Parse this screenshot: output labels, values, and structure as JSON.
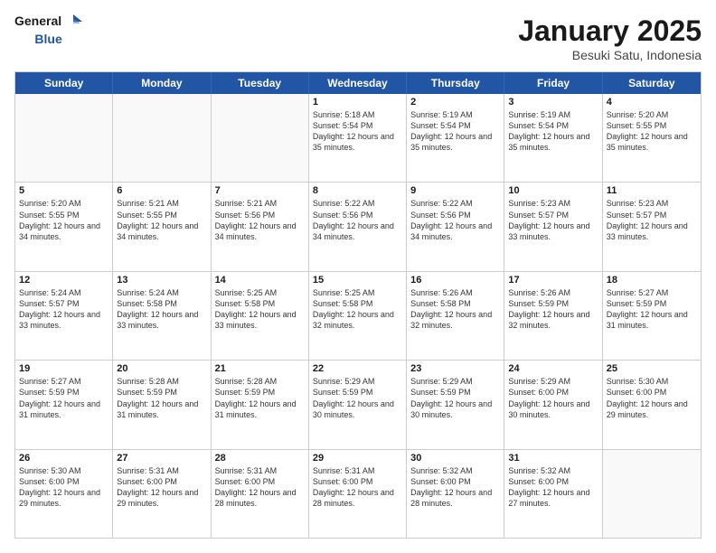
{
  "header": {
    "logo_line1": "General",
    "logo_line2": "Blue",
    "month_title": "January 2025",
    "location": "Besuki Satu, Indonesia"
  },
  "days_of_week": [
    "Sunday",
    "Monday",
    "Tuesday",
    "Wednesday",
    "Thursday",
    "Friday",
    "Saturday"
  ],
  "weeks": [
    [
      {
        "num": "",
        "sunrise": "",
        "sunset": "",
        "daylight": "",
        "empty": true
      },
      {
        "num": "",
        "sunrise": "",
        "sunset": "",
        "daylight": "",
        "empty": true
      },
      {
        "num": "",
        "sunrise": "",
        "sunset": "",
        "daylight": "",
        "empty": true
      },
      {
        "num": "1",
        "sunrise": "Sunrise: 5:18 AM",
        "sunset": "Sunset: 5:54 PM",
        "daylight": "Daylight: 12 hours and 35 minutes."
      },
      {
        "num": "2",
        "sunrise": "Sunrise: 5:19 AM",
        "sunset": "Sunset: 5:54 PM",
        "daylight": "Daylight: 12 hours and 35 minutes."
      },
      {
        "num": "3",
        "sunrise": "Sunrise: 5:19 AM",
        "sunset": "Sunset: 5:54 PM",
        "daylight": "Daylight: 12 hours and 35 minutes."
      },
      {
        "num": "4",
        "sunrise": "Sunrise: 5:20 AM",
        "sunset": "Sunset: 5:55 PM",
        "daylight": "Daylight: 12 hours and 35 minutes."
      }
    ],
    [
      {
        "num": "5",
        "sunrise": "Sunrise: 5:20 AM",
        "sunset": "Sunset: 5:55 PM",
        "daylight": "Daylight: 12 hours and 34 minutes."
      },
      {
        "num": "6",
        "sunrise": "Sunrise: 5:21 AM",
        "sunset": "Sunset: 5:55 PM",
        "daylight": "Daylight: 12 hours and 34 minutes."
      },
      {
        "num": "7",
        "sunrise": "Sunrise: 5:21 AM",
        "sunset": "Sunset: 5:56 PM",
        "daylight": "Daylight: 12 hours and 34 minutes."
      },
      {
        "num": "8",
        "sunrise": "Sunrise: 5:22 AM",
        "sunset": "Sunset: 5:56 PM",
        "daylight": "Daylight: 12 hours and 34 minutes."
      },
      {
        "num": "9",
        "sunrise": "Sunrise: 5:22 AM",
        "sunset": "Sunset: 5:56 PM",
        "daylight": "Daylight: 12 hours and 34 minutes."
      },
      {
        "num": "10",
        "sunrise": "Sunrise: 5:23 AM",
        "sunset": "Sunset: 5:57 PM",
        "daylight": "Daylight: 12 hours and 33 minutes."
      },
      {
        "num": "11",
        "sunrise": "Sunrise: 5:23 AM",
        "sunset": "Sunset: 5:57 PM",
        "daylight": "Daylight: 12 hours and 33 minutes."
      }
    ],
    [
      {
        "num": "12",
        "sunrise": "Sunrise: 5:24 AM",
        "sunset": "Sunset: 5:57 PM",
        "daylight": "Daylight: 12 hours and 33 minutes."
      },
      {
        "num": "13",
        "sunrise": "Sunrise: 5:24 AM",
        "sunset": "Sunset: 5:58 PM",
        "daylight": "Daylight: 12 hours and 33 minutes."
      },
      {
        "num": "14",
        "sunrise": "Sunrise: 5:25 AM",
        "sunset": "Sunset: 5:58 PM",
        "daylight": "Daylight: 12 hours and 33 minutes."
      },
      {
        "num": "15",
        "sunrise": "Sunrise: 5:25 AM",
        "sunset": "Sunset: 5:58 PM",
        "daylight": "Daylight: 12 hours and 32 minutes."
      },
      {
        "num": "16",
        "sunrise": "Sunrise: 5:26 AM",
        "sunset": "Sunset: 5:58 PM",
        "daylight": "Daylight: 12 hours and 32 minutes."
      },
      {
        "num": "17",
        "sunrise": "Sunrise: 5:26 AM",
        "sunset": "Sunset: 5:59 PM",
        "daylight": "Daylight: 12 hours and 32 minutes."
      },
      {
        "num": "18",
        "sunrise": "Sunrise: 5:27 AM",
        "sunset": "Sunset: 5:59 PM",
        "daylight": "Daylight: 12 hours and 31 minutes."
      }
    ],
    [
      {
        "num": "19",
        "sunrise": "Sunrise: 5:27 AM",
        "sunset": "Sunset: 5:59 PM",
        "daylight": "Daylight: 12 hours and 31 minutes."
      },
      {
        "num": "20",
        "sunrise": "Sunrise: 5:28 AM",
        "sunset": "Sunset: 5:59 PM",
        "daylight": "Daylight: 12 hours and 31 minutes."
      },
      {
        "num": "21",
        "sunrise": "Sunrise: 5:28 AM",
        "sunset": "Sunset: 5:59 PM",
        "daylight": "Daylight: 12 hours and 31 minutes."
      },
      {
        "num": "22",
        "sunrise": "Sunrise: 5:29 AM",
        "sunset": "Sunset: 5:59 PM",
        "daylight": "Daylight: 12 hours and 30 minutes."
      },
      {
        "num": "23",
        "sunrise": "Sunrise: 5:29 AM",
        "sunset": "Sunset: 5:59 PM",
        "daylight": "Daylight: 12 hours and 30 minutes."
      },
      {
        "num": "24",
        "sunrise": "Sunrise: 5:29 AM",
        "sunset": "Sunset: 6:00 PM",
        "daylight": "Daylight: 12 hours and 30 minutes."
      },
      {
        "num": "25",
        "sunrise": "Sunrise: 5:30 AM",
        "sunset": "Sunset: 6:00 PM",
        "daylight": "Daylight: 12 hours and 29 minutes."
      }
    ],
    [
      {
        "num": "26",
        "sunrise": "Sunrise: 5:30 AM",
        "sunset": "Sunset: 6:00 PM",
        "daylight": "Daylight: 12 hours and 29 minutes."
      },
      {
        "num": "27",
        "sunrise": "Sunrise: 5:31 AM",
        "sunset": "Sunset: 6:00 PM",
        "daylight": "Daylight: 12 hours and 29 minutes."
      },
      {
        "num": "28",
        "sunrise": "Sunrise: 5:31 AM",
        "sunset": "Sunset: 6:00 PM",
        "daylight": "Daylight: 12 hours and 28 minutes."
      },
      {
        "num": "29",
        "sunrise": "Sunrise: 5:31 AM",
        "sunset": "Sunset: 6:00 PM",
        "daylight": "Daylight: 12 hours and 28 minutes."
      },
      {
        "num": "30",
        "sunrise": "Sunrise: 5:32 AM",
        "sunset": "Sunset: 6:00 PM",
        "daylight": "Daylight: 12 hours and 28 minutes."
      },
      {
        "num": "31",
        "sunrise": "Sunrise: 5:32 AM",
        "sunset": "Sunset: 6:00 PM",
        "daylight": "Daylight: 12 hours and 27 minutes."
      },
      {
        "num": "",
        "sunrise": "",
        "sunset": "",
        "daylight": "",
        "empty": true
      }
    ]
  ]
}
